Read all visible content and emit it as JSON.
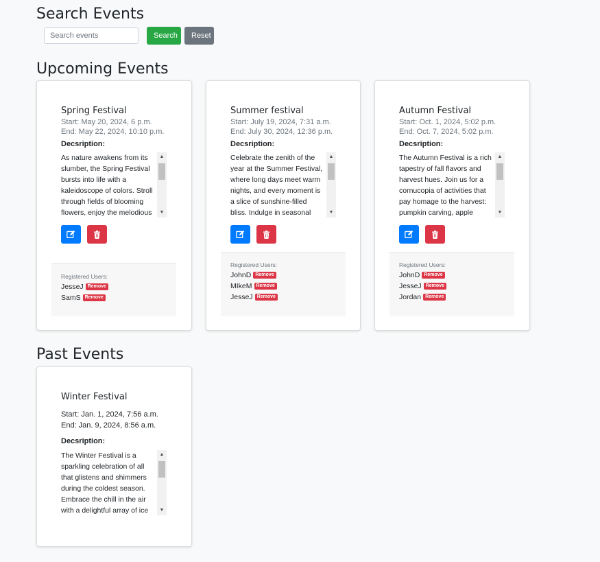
{
  "search": {
    "title": "Search Events",
    "placeholder": "Search events",
    "search_label": "Search",
    "reset_label": "Reset"
  },
  "upcoming": {
    "title": "Upcoming Events",
    "events": [
      {
        "name": "Spring Festival",
        "start": "Start: May 20, 2024, 6 p.m.",
        "end": "End: May 22, 2024, 10:10 p.m.",
        "desc_label": "Decsription:",
        "description": "As nature awakens from its slumber, the Spring Festival bursts into life with a kaleidoscope of colors. Stroll through fields of blooming flowers, enjoy the melodious",
        "users_label": "Registered Users:",
        "users": [
          "JesseJ",
          "SamS"
        ],
        "remove_label": "Remove"
      },
      {
        "name": "Summer festival",
        "start": "Start: July 19, 2024, 7:31 a.m.",
        "end": "End: July 30, 2024, 12:36 p.m.",
        "desc_label": "Decsription:",
        "description": "Celebrate the zenith of the year at the Summer Festival, where long days meet warm nights, and every moment is a slice of sunshine-filled bliss. Indulge in seasonal fruits,",
        "users_label": "Registered Users:",
        "users": [
          "JohnD",
          "MIkeM",
          "JesseJ"
        ],
        "remove_label": "Remove"
      },
      {
        "name": "Autumn Festival",
        "start": "Start: Oct. 1, 2024, 5:02 p.m.",
        "end": "End: Oct. 7, 2024, 5:02 p.m.",
        "desc_label": "Decsription:",
        "description": "The Autumn Festival is a rich tapestry of fall flavors and harvest hues. Join us for a cornucopia of activities that pay homage to the harvest: pumpkin carving, apple",
        "users_label": "Registered Users:",
        "users": [
          "JohnD",
          "JesseJ",
          "Jordan"
        ],
        "remove_label": "Remove"
      }
    ]
  },
  "past": {
    "title": "Past Events",
    "events": [
      {
        "name": "Winter Festival",
        "start": "Start: Jan. 1, 2024, 7:56 a.m.",
        "end": "End: Jan. 9, 2024, 8:56 a.m.",
        "desc_label": "Decsription:",
        "description": "The Winter Festival is a sparkling celebration of all that glistens and shimmers during the coldest season. Embrace the chill in the air with a delightful array of ice"
      }
    ]
  },
  "icons": {
    "edit": "edit-icon",
    "delete": "trash-icon"
  },
  "colors": {
    "primary": "#007bff",
    "success": "#28a745",
    "danger": "#dc3545",
    "secondary": "#6c757d"
  }
}
